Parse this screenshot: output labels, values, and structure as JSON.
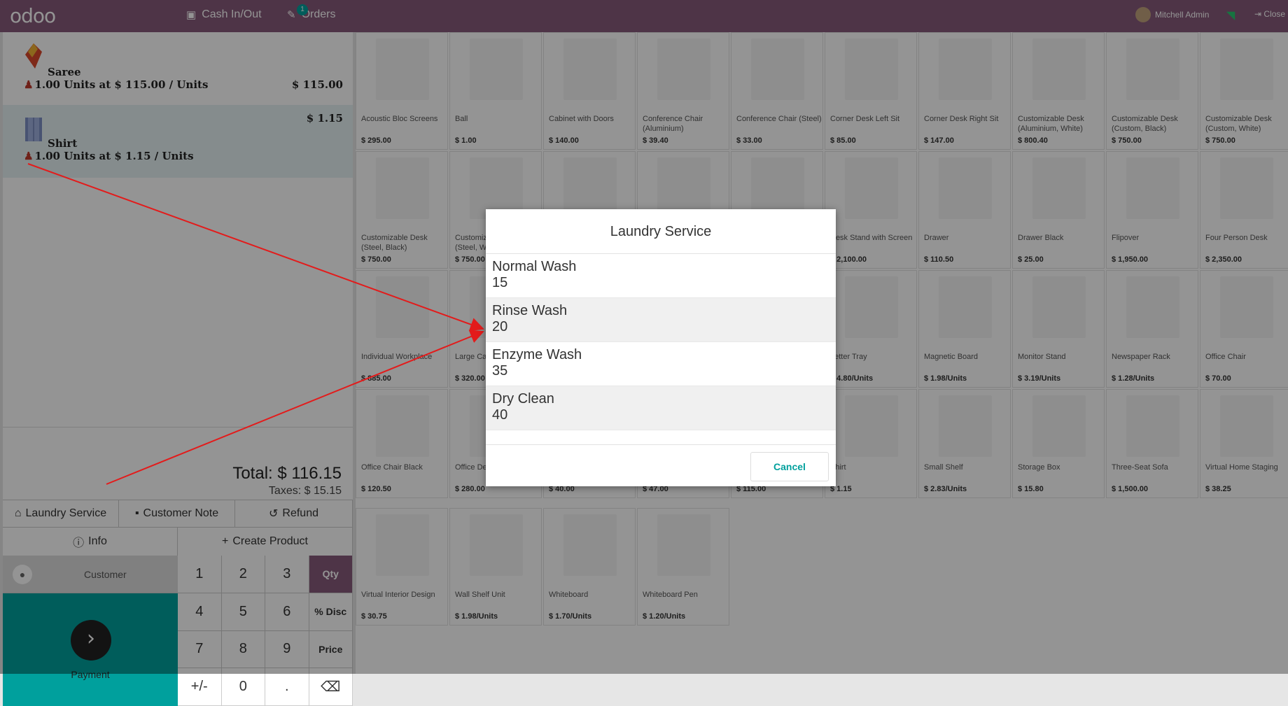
{
  "topbar": {
    "logo": "odoo",
    "cash_in_out": "Cash In/Out",
    "orders_label": "Orders",
    "orders_badge": "1",
    "user_name": "Mitchell Admin",
    "close_label": "Close"
  },
  "order_lines": [
    {
      "name": "Saree",
      "info": "1.00 Units at $ 115.00 / Units",
      "price": "$ 115.00"
    },
    {
      "name": "Shirt",
      "info": "1.00 Units at $ 1.15 / Units",
      "price": "$ 1.15"
    }
  ],
  "totals": {
    "total": "Total: $ 116.15",
    "taxes": "Taxes: $ 15.15"
  },
  "controls": {
    "laundry": "Laundry Service",
    "customer_note": "Customer Note",
    "refund": "Refund"
  },
  "actions": {
    "info": "Info",
    "create_product": "Create Product"
  },
  "customer_label": "Customer",
  "payment_label": "Payment",
  "numpad": [
    "1",
    "2",
    "3",
    "Qty",
    "4",
    "5",
    "6",
    "% Disc",
    "7",
    "8",
    "9",
    "Price",
    "+/-",
    "0",
    ".",
    "⌫"
  ],
  "products": [
    {
      "name": "Acoustic Bloc Screens",
      "price": "$ 295.00"
    },
    {
      "name": "Ball",
      "price": "$ 1.00"
    },
    {
      "name": "Cabinet with Doors",
      "price": "$ 140.00"
    },
    {
      "name": "Conference Chair (Aluminium)",
      "price": "$ 39.40"
    },
    {
      "name": "Conference Chair (Steel)",
      "price": "$ 33.00"
    },
    {
      "name": "Corner Desk Left Sit",
      "price": "$ 85.00"
    },
    {
      "name": "Corner Desk Right Sit",
      "price": "$ 147.00"
    },
    {
      "name": "Customizable Desk (Aluminium, White)",
      "price": "$ 800.40"
    },
    {
      "name": "Customizable Desk (Custom, Black)",
      "price": "$ 750.00"
    },
    {
      "name": "Customizable Desk (Custom, White)",
      "price": "$ 750.00"
    },
    {
      "name": "Customizable Desk (Steel, Black)",
      "price": "$ 750.00"
    },
    {
      "name": "Customizable Desk (Steel, White)",
      "price": "$ 750.00"
    },
    {
      "name": "",
      "price": ""
    },
    {
      "name": "",
      "price": ""
    },
    {
      "name": "",
      "price": ""
    },
    {
      "name": "Desk Stand with Screen",
      "price": "$ 2,100.00"
    },
    {
      "name": "Drawer",
      "price": "$ 110.50"
    },
    {
      "name": "Drawer Black",
      "price": "$ 25.00"
    },
    {
      "name": "Flipover",
      "price": "$ 1,950.00"
    },
    {
      "name": "Four Person Desk",
      "price": "$ 2,350.00"
    },
    {
      "name": "Individual Workplace",
      "price": "$ 885.00"
    },
    {
      "name": "Large Cabinet",
      "price": "$ 320.00"
    },
    {
      "name": "",
      "price": ""
    },
    {
      "name": "",
      "price": ""
    },
    {
      "name": "",
      "price": ""
    },
    {
      "name": "Letter Tray",
      "price": "$ 4.80/Units"
    },
    {
      "name": "Magnetic Board",
      "price": "$ 1.98/Units"
    },
    {
      "name": "Monitor Stand",
      "price": "$ 3.19/Units"
    },
    {
      "name": "Newspaper Rack",
      "price": "$ 1.28/Units"
    },
    {
      "name": "Office Chair",
      "price": "$ 70.00"
    },
    {
      "name": "Office Chair Black",
      "price": "$ 120.50"
    },
    {
      "name": "Office Design Software",
      "price": "$ 280.00"
    },
    {
      "name": "",
      "price": "$ 40.00"
    },
    {
      "name": "",
      "price": "$ 47.00"
    },
    {
      "name": "",
      "price": "$ 115.00"
    },
    {
      "name": "Shirt",
      "price": "$ 1.15"
    },
    {
      "name": "Small Shelf",
      "price": "$ 2.83/Units"
    },
    {
      "name": "Storage Box",
      "price": "$ 15.80"
    },
    {
      "name": "Three-Seat Sofa",
      "price": "$ 1,500.00"
    },
    {
      "name": "Virtual Home Staging",
      "price": "$ 38.25"
    },
    {
      "name": "Virtual Interior Design",
      "price": "$ 30.75"
    },
    {
      "name": "Wall Shelf Unit",
      "price": "$ 1.98/Units"
    },
    {
      "name": "Whiteboard",
      "price": "$ 1.70/Units"
    },
    {
      "name": "Whiteboard Pen",
      "price": "$ 1.20/Units"
    }
  ],
  "dialog": {
    "title": "Laundry Service",
    "options": [
      {
        "name": "Normal Wash",
        "value": "15"
      },
      {
        "name": "Rinse Wash",
        "value": "20"
      },
      {
        "name": "Enzyme Wash",
        "value": "35"
      },
      {
        "name": "Dry Clean",
        "value": "40"
      }
    ],
    "cancel": "Cancel"
  },
  "colors": {
    "brand": "#875a7b",
    "accent": "#00a09d",
    "arrow": "#e31b1b"
  }
}
